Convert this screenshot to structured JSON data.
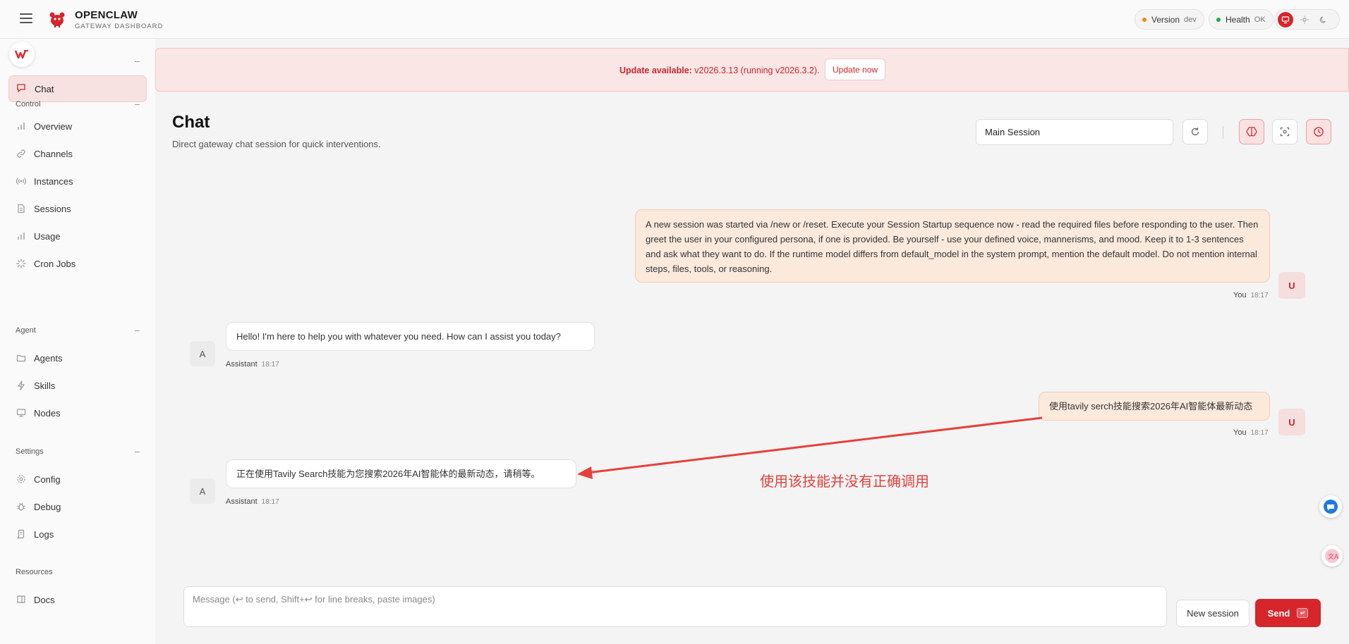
{
  "header": {
    "brand_title": "OPENCLAW",
    "brand_subtitle": "GATEWAY DASHBOARD",
    "version_label": "Version",
    "version_value": "dev",
    "health_label": "Health",
    "health_value": "OK",
    "version_dot_color": "#f08a00",
    "health_dot_color": "#22aa44"
  },
  "sidebar": {
    "active_item": "Chat",
    "sections": [
      {
        "label": "Control",
        "items": [
          "Overview",
          "Channels",
          "Instances",
          "Sessions",
          "Usage",
          "Cron Jobs"
        ]
      },
      {
        "label": "Agent",
        "items": [
          "Agents",
          "Skills",
          "Nodes"
        ]
      },
      {
        "label": "Settings",
        "items": [
          "Config",
          "Debug",
          "Logs"
        ]
      },
      {
        "label": "Resources",
        "items": [
          "Docs"
        ]
      }
    ]
  },
  "banner": {
    "prefix": "Update available:",
    "message": " v2026.3.13 (running v2026.3.2).",
    "button": "Update now"
  },
  "page": {
    "title": "Chat",
    "subtitle": "Direct gateway chat session for quick interventions.",
    "session_value": "Main Session"
  },
  "messages": [
    {
      "role": "user",
      "sender": "You",
      "time": "18:17",
      "avatar": "U",
      "text": "A new session was started via /new or /reset. Execute your Session Startup sequence now - read the required files before responding to the user. Then greet the user in your configured persona, if one is provided. Be yourself - use your defined voice, mannerisms, and mood. Keep it to 1-3 sentences and ask what they want to do. If the runtime model differs from default_model in the system prompt, mention the default model. Do not mention internal steps, files, tools, or reasoning."
    },
    {
      "role": "assistant",
      "sender": "Assistant",
      "time": "18:17",
      "avatar": "A",
      "text": "Hello! I'm here to help you with whatever you need. How can I assist you today?"
    },
    {
      "role": "user",
      "sender": "You",
      "time": "18:17",
      "avatar": "U",
      "text": "使用tavily serch技能搜索2026年AI智能体最新动态"
    },
    {
      "role": "assistant",
      "sender": "Assistant",
      "time": "18:17",
      "avatar": "A",
      "text": "正在使用Tavily Search技能为您搜索2026年AI智能体的最新动态，请稍等。"
    }
  ],
  "annotation": "使用该技能并没有正确调用",
  "composer": {
    "placeholder": "Message (↩ to send, Shift+↩ for line breaks, paste images)",
    "new_session": "New session",
    "send": "Send",
    "send_key": "↵"
  },
  "colors": {
    "accent": "#d6262b",
    "annotation": "#e6403a"
  }
}
